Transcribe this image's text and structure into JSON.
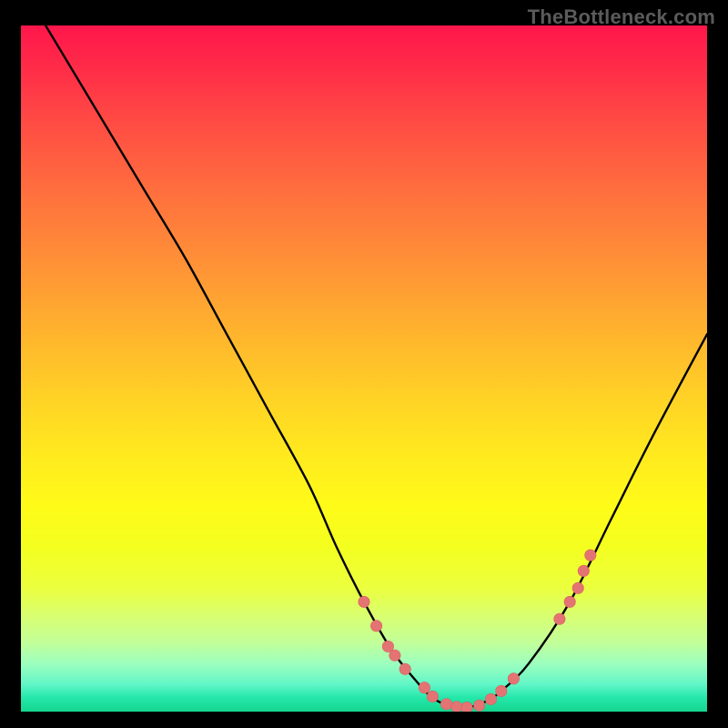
{
  "domain": "Chart",
  "watermark": "TheBottleneck.com",
  "colors": {
    "page_bg": "#000000",
    "watermark_text": "#5b5b5b",
    "curve": "#000000",
    "marker_fill": "#e47474",
    "marker_stroke": "#d85e5e",
    "gradient_stops": [
      "#ff164b",
      "#ff2b48",
      "#ff4b44",
      "#ff6e3e",
      "#ff8f37",
      "#ffb12e",
      "#ffd126",
      "#ffe81f",
      "#fffb18",
      "#f4ff20",
      "#ebff3e",
      "#d9ff70",
      "#c1ff9a",
      "#9dffbe",
      "#62f6c7",
      "#24e7a9",
      "#15d58f"
    ]
  },
  "chart_data": {
    "type": "line",
    "title": "",
    "xlabel": "",
    "ylabel": "",
    "xlim": [
      0,
      100
    ],
    "ylim": [
      0,
      100
    ],
    "legend": false,
    "grid": false,
    "axes_visible": false,
    "note": "Curve is a V-shape; x expressed as % of plot width, y as % of plot height where 0=bottom, 100=top. Bottleneck-style chart: vertical gradient bg, minima = optimal region; scatter markers cluster near minimum.",
    "series": [
      {
        "name": "bottleneck-curve",
        "x": [
          3.6,
          6.6,
          12,
          18,
          24,
          30,
          36,
          42,
          46,
          50,
          54,
          58,
          60,
          62,
          64,
          66,
          68,
          70,
          74,
          80,
          86,
          92,
          100
        ],
        "y": [
          100,
          95,
          86,
          76,
          66,
          55,
          44,
          33,
          24,
          16,
          9,
          4,
          2,
          1,
          0.6,
          0.8,
          1.6,
          3,
          7,
          16,
          28,
          40,
          55
        ]
      }
    ],
    "markers": {
      "name": "sample-points",
      "note": "Pink dots overlaid on the curve; clustered at the trough and sparse on the rising branches.",
      "x": [
        50.0,
        51.8,
        53.5,
        54.5,
        56.0,
        58.8,
        60.0,
        62.0,
        63.5,
        65.0,
        66.8,
        68.5,
        70.0,
        71.8,
        78.5,
        80.0,
        81.2,
        82.0,
        83.0
      ],
      "y": [
        16.0,
        12.5,
        9.5,
        8.2,
        6.2,
        3.5,
        2.2,
        1.1,
        0.7,
        0.6,
        0.9,
        1.8,
        3.0,
        4.8,
        13.5,
        16.0,
        18.0,
        20.5,
        22.8
      ]
    }
  }
}
